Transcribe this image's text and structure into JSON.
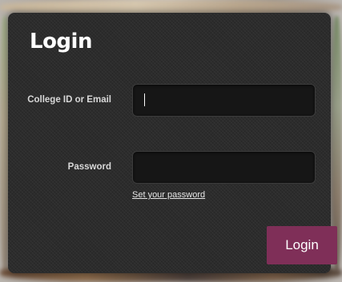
{
  "title": "Login",
  "form": {
    "id_label": "College ID or Email",
    "id_value": "",
    "password_label": "Password",
    "password_value": "",
    "set_password_link": "Set your password",
    "submit_label": "Login"
  },
  "colors": {
    "panel_bg": "#2c2c2c",
    "field_bg": "#161616",
    "button_bg": "#7f2f58",
    "text": "#ffffff"
  }
}
